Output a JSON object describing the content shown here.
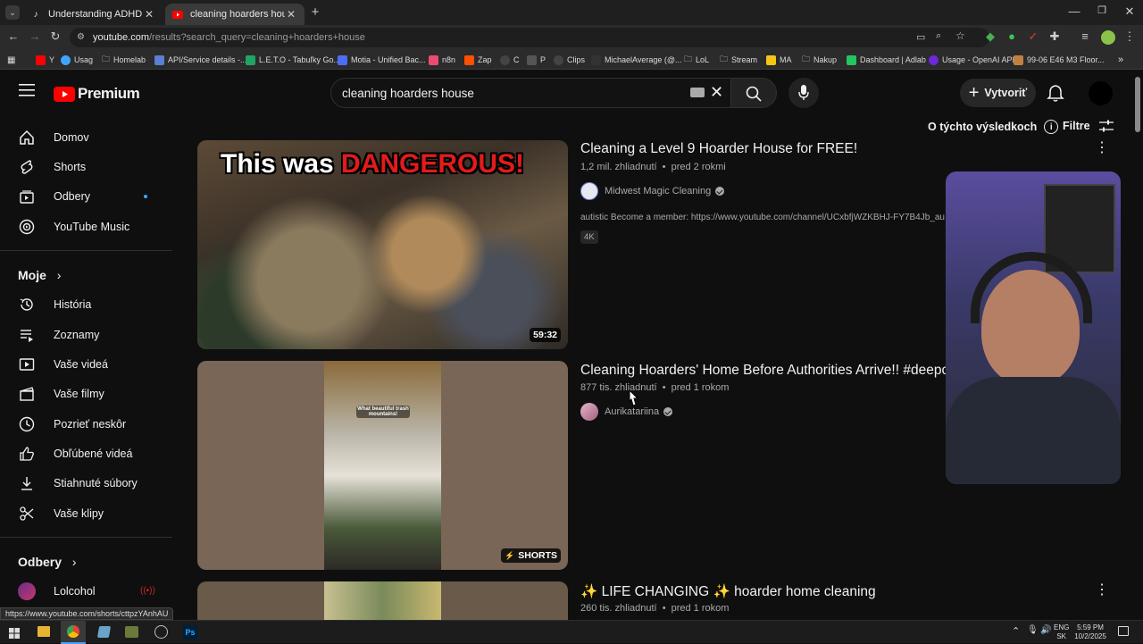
{
  "browser": {
    "tabs": [
      {
        "title": "Understanding ADHD Motivat",
        "favicon": "tiktok-icon",
        "active": false
      },
      {
        "title": "cleaning hoarders house - You",
        "favicon": "youtube-icon",
        "active": true
      }
    ],
    "new_tab_label": "+",
    "url_host": "youtube.com",
    "url_path": "/results?search_query=cleaning+hoarders+house",
    "bookmarks": [
      {
        "label": "Y",
        "color": "#ff0000"
      },
      {
        "label": "Usag",
        "color": "#3ea6ff"
      },
      {
        "label": "Homelab",
        "color": "#8a8a8a"
      },
      {
        "label": "API/Service details -...",
        "color": "#5b7fd6"
      },
      {
        "label": "L.E.T.O - Tabuľky Go...",
        "color": "#1fa463"
      },
      {
        "label": "Motia - Unified Bac...",
        "color": "#4c6ef5"
      },
      {
        "label": "n8n",
        "color": "#ea4b71"
      },
      {
        "label": "Zap",
        "color": "#ff4f00"
      },
      {
        "label": "C",
        "color": "#ffffff"
      },
      {
        "label": "P",
        "color": "#ffffff"
      },
      {
        "label": "Clips",
        "color": "#ffffff"
      },
      {
        "label": "MichaelAverage (@...",
        "color": "#ffffff"
      },
      {
        "label": "LoL",
        "color": "#8a8a8a"
      },
      {
        "label": "Stream",
        "color": "#8a8a8a"
      },
      {
        "label": "MA",
        "color": "#f5c518"
      },
      {
        "label": "Nakup",
        "color": "#8a8a8a"
      },
      {
        "label": "Dashboard | Adlab",
        "color": "#22c55e"
      },
      {
        "label": "Usage - OpenAI API",
        "color": "#6d28d9"
      },
      {
        "label": "99-06 E46 M3 Floor...",
        "color": "#c08040"
      }
    ],
    "status_url": "https://www.youtube.com/shorts/cttpzYAnhAU"
  },
  "youtube": {
    "logo_text": "Premium",
    "search_value": "cleaning hoarders house",
    "create_label": "Vytvoriť",
    "about_results": "O týchto výsledkoch",
    "filters_label": "Filtre",
    "sidebar": {
      "main": [
        {
          "label": "Domov",
          "icon": "home-icon"
        },
        {
          "label": "Shorts",
          "icon": "shorts-icon"
        },
        {
          "label": "Odbery",
          "icon": "subscriptions-icon"
        },
        {
          "label": "YouTube Music",
          "icon": "music-icon"
        }
      ],
      "you_title": "Moje",
      "you": [
        {
          "label": "História",
          "icon": "history-icon"
        },
        {
          "label": "Zoznamy",
          "icon": "playlists-icon"
        },
        {
          "label": "Vaše videá",
          "icon": "your-videos-icon"
        },
        {
          "label": "Vaše filmy",
          "icon": "movies-icon"
        },
        {
          "label": "Pozrieť neskôr",
          "icon": "watch-later-icon"
        },
        {
          "label": "Obľúbené videá",
          "icon": "liked-icon"
        },
        {
          "label": "Stiahnuté súbory",
          "icon": "download-icon"
        },
        {
          "label": "Vaše klipy",
          "icon": "clips-icon"
        }
      ],
      "subs_title": "Odbery",
      "subs": [
        {
          "label": "Lolcohol"
        }
      ]
    },
    "results": [
      {
        "title": "Cleaning a Level 9 Hoarder House for FREE!",
        "views": "1,2 mil. zhliadnutí",
        "age": "pred 2 rokmi",
        "channel": "Midwest Magic Cleaning",
        "description": "autistic Become a member: https://www.youtube.com/channel/UCxbfjWZKBHJ-FY7B4Jb_au",
        "tag": "4K",
        "duration": "59:32",
        "thumb_caption_white": "This was ",
        "thumb_caption_red": "DANGEROUS!"
      },
      {
        "title": "Cleaning Hoarders' Home Before Authorities Arrive!! #deepcle",
        "views": "877 tis. zhliadnutí",
        "age": "pred 1 rokom",
        "channel": "Aurikatariina",
        "badge": "SHORTS",
        "thumb_caption": "What beautiful trash mountains!"
      },
      {
        "title": "✨ LIFE CHANGING ✨ hoarder home cleaning",
        "views": "260 tis. zhliadnutí",
        "age": "pred 1 rokom"
      }
    ],
    "sep": "•"
  },
  "taskbar": {
    "lang": "ENG",
    "region": "SK",
    "time": "5:59 PM",
    "date": "10/2/2025"
  }
}
